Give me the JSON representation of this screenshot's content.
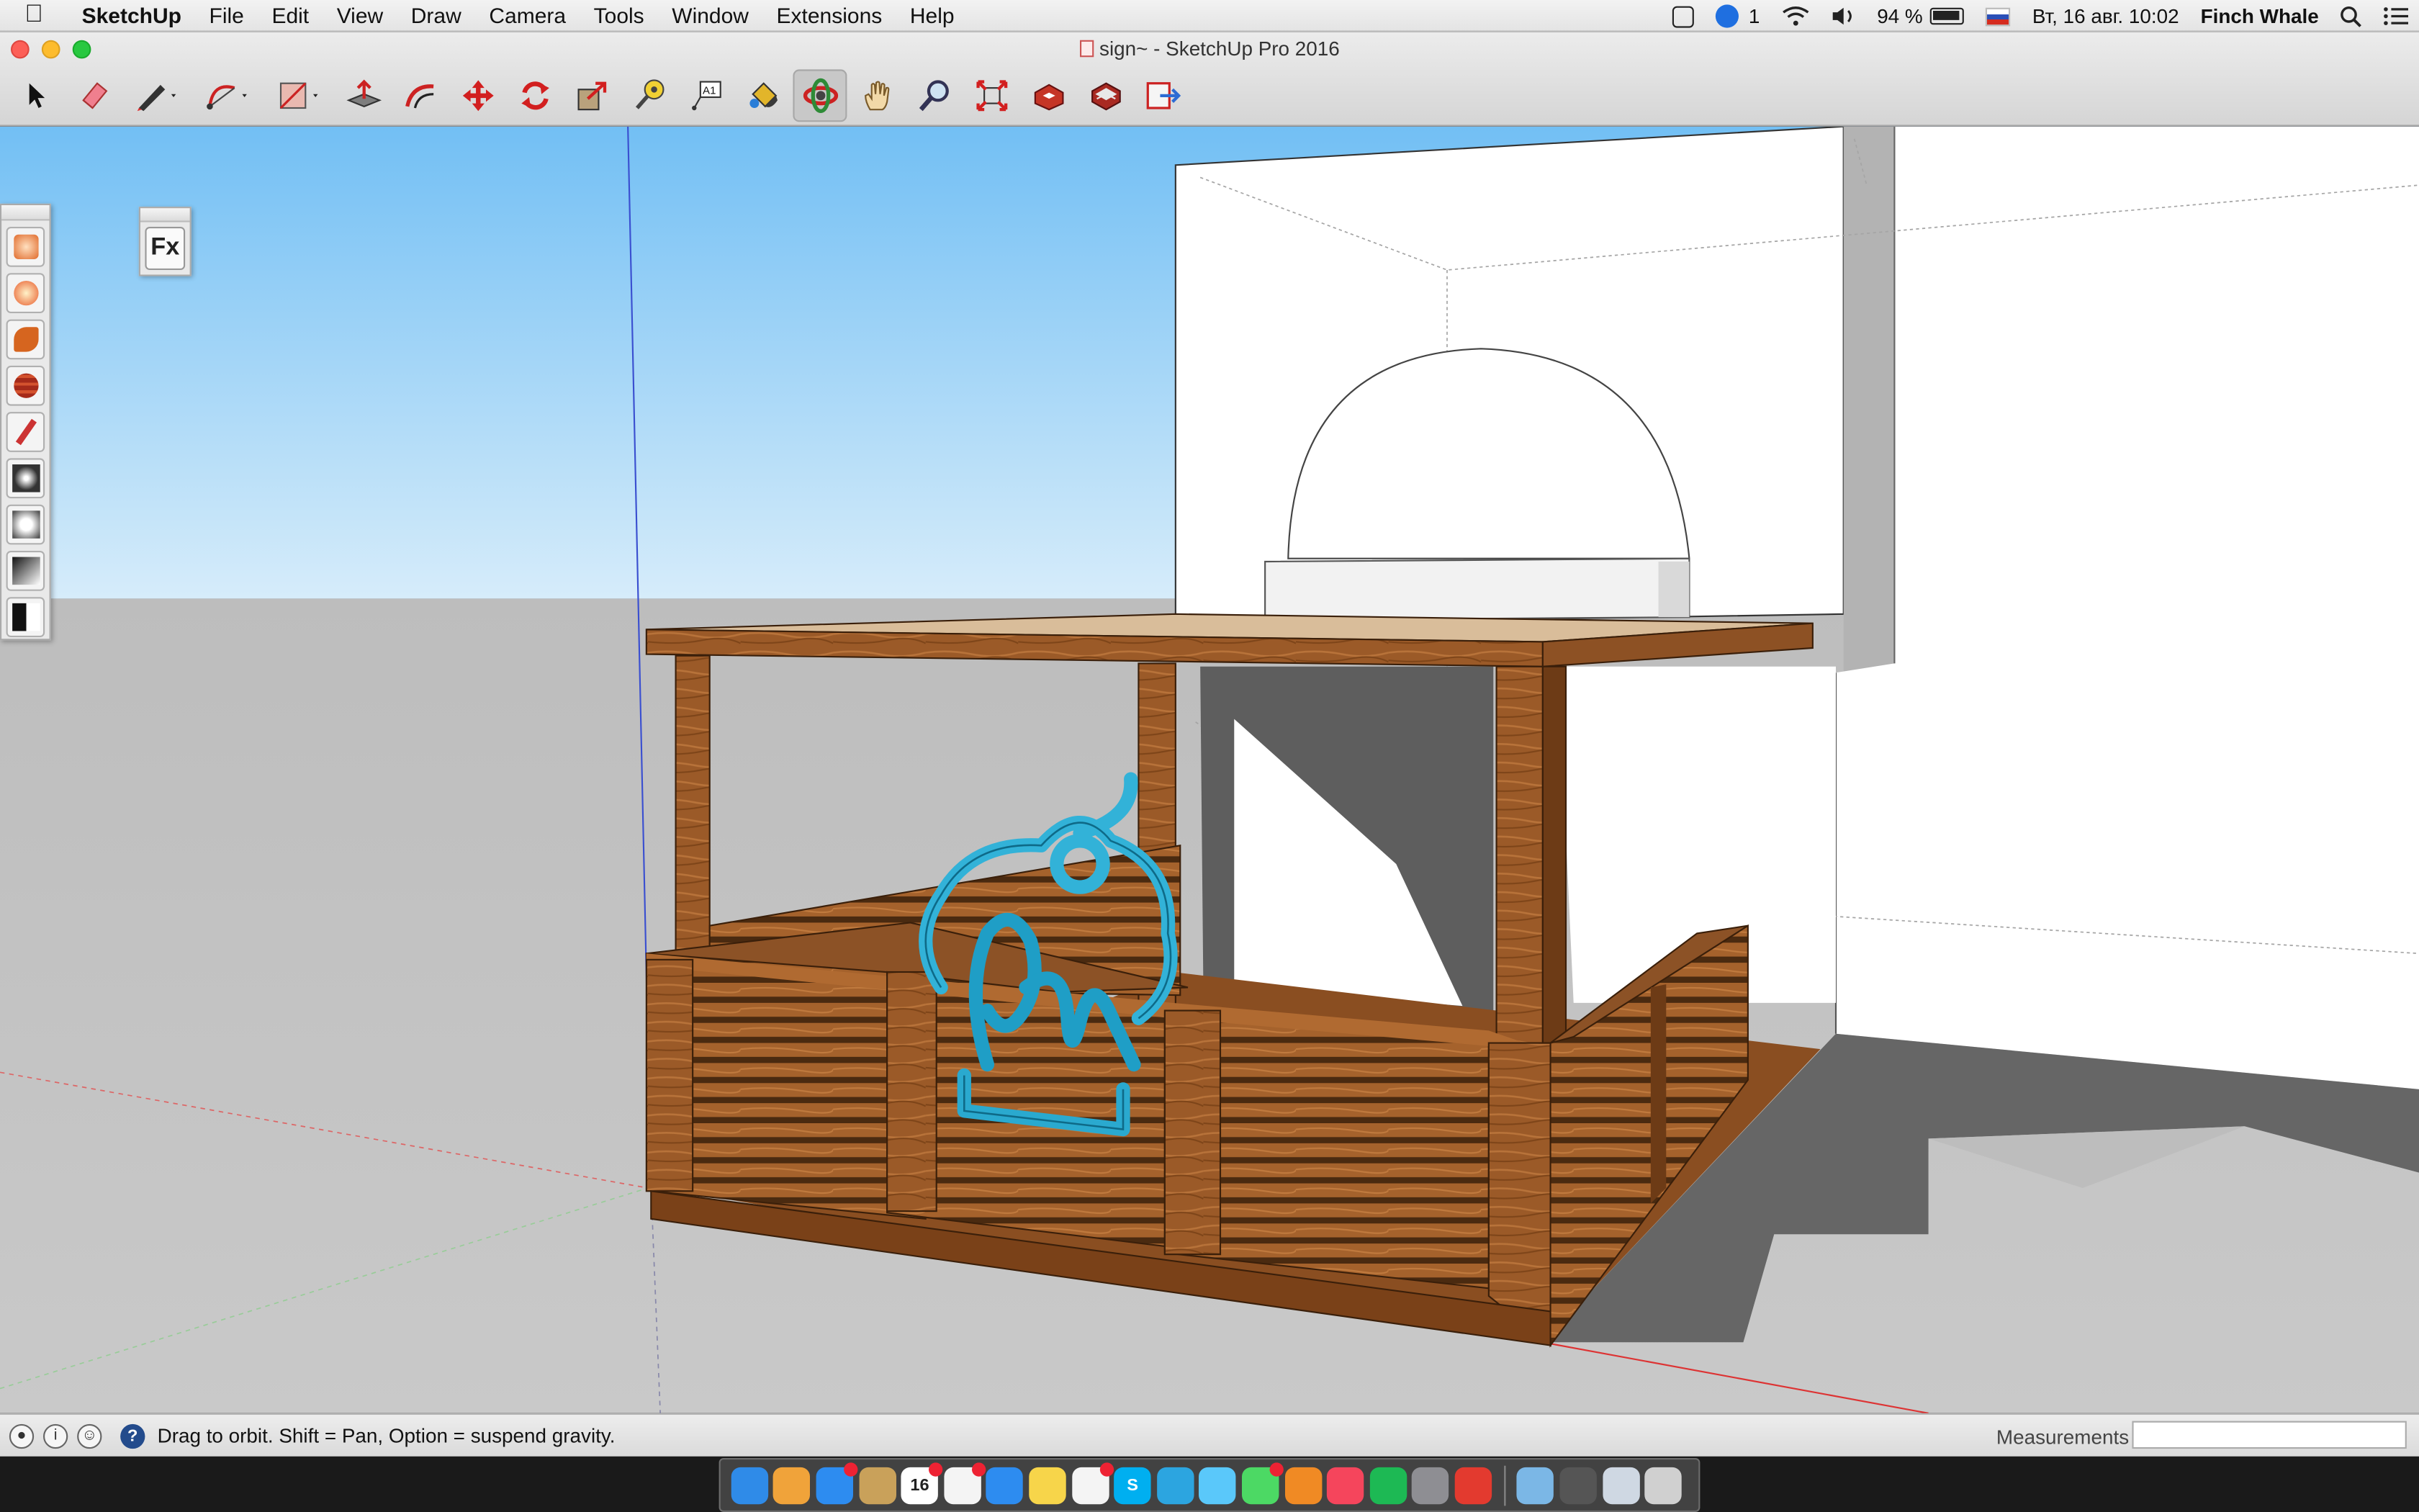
{
  "menubar": {
    "app_name": "SketchUp",
    "items": [
      "File",
      "Edit",
      "View",
      "Draw",
      "Camera",
      "Tools",
      "Window",
      "Extensions",
      "Help"
    ],
    "status": {
      "notification_count": "1",
      "battery_percent": "94 %",
      "datetime": "Вт, 16 авг.  10:02",
      "user": "Finch Whale"
    }
  },
  "window": {
    "title": "sign~ - SketchUp Pro 2016"
  },
  "toolbar": {
    "tools": [
      {
        "name": "select-tool",
        "icon": "arrow-cursor-icon"
      },
      {
        "name": "eraser-tool",
        "icon": "eraser-icon"
      },
      {
        "name": "line-tool",
        "icon": "pencil-icon",
        "dropdown": true
      },
      {
        "name": "arc-tool",
        "icon": "arc-icon",
        "dropdown": true
      },
      {
        "name": "shape-tool",
        "icon": "rectangle-icon",
        "dropdown": true
      },
      {
        "name": "push-pull-tool",
        "icon": "push-pull-icon"
      },
      {
        "name": "offset-tool",
        "icon": "offset-icon"
      },
      {
        "name": "move-tool",
        "icon": "move-icon"
      },
      {
        "name": "rotate-tool",
        "icon": "rotate-icon"
      },
      {
        "name": "scale-tool",
        "icon": "scale-icon"
      },
      {
        "name": "tape-measure-tool",
        "icon": "tape-measure-icon"
      },
      {
        "name": "text-tool",
        "icon": "text-icon"
      },
      {
        "name": "paint-bucket-tool",
        "icon": "paint-bucket-icon"
      },
      {
        "name": "orbit-tool",
        "icon": "orbit-icon",
        "active": true
      },
      {
        "name": "pan-tool",
        "icon": "hand-icon"
      },
      {
        "name": "zoom-tool",
        "icon": "magnifier-icon"
      },
      {
        "name": "zoom-extents-tool",
        "icon": "zoom-extents-icon"
      },
      {
        "name": "warehouse-tool",
        "icon": "warehouse-icon"
      },
      {
        "name": "extension-warehouse-tool",
        "icon": "extension-warehouse-icon"
      },
      {
        "name": "layout-send-tool",
        "icon": "layout-icon"
      }
    ]
  },
  "render_palette": {
    "buttons": [
      "render-icon",
      "light-bulb-icon",
      "material-editor-icon",
      "texture-icon",
      "paint-icon",
      "light-icon",
      "sphere-icon",
      "gradient-icon",
      "section-icon"
    ]
  },
  "fx_palette": {
    "label": "Fx"
  },
  "statusbar": {
    "hint": "Drag to orbit. Shift = Pan, Option = suspend gravity.",
    "measurements_label": "Measurements",
    "measurements_value": ""
  },
  "dock": {
    "apps": [
      {
        "name": "finder",
        "color": "#2f8be8"
      },
      {
        "name": "photos",
        "color": "#f0a33a"
      },
      {
        "name": "app-store",
        "color": "#2d8cf0",
        "badge": true
      },
      {
        "name": "notes-book",
        "color": "#c9a15a"
      },
      {
        "name": "calendar",
        "color": "#ffffff",
        "label": "16",
        "badge": true
      },
      {
        "name": "reminders",
        "color": "#f4f4f4",
        "badge": true
      },
      {
        "name": "safari",
        "color": "#2d8cf0"
      },
      {
        "name": "notes",
        "color": "#f7d54a"
      },
      {
        "name": "lists",
        "color": "#f4f4f4",
        "badge": true
      },
      {
        "name": "skype",
        "color": "#00aff0",
        "label": "S"
      },
      {
        "name": "telegram",
        "color": "#2ca5e0"
      },
      {
        "name": "messages",
        "color": "#5ac8fa"
      },
      {
        "name": "facetime",
        "color": "#4cd964",
        "badge": true
      },
      {
        "name": "ibooks",
        "color": "#f08a24"
      },
      {
        "name": "itunes",
        "color": "#f5455c"
      },
      {
        "name": "spotify",
        "color": "#1db954"
      },
      {
        "name": "system-preferences",
        "color": "#8e8e93"
      },
      {
        "name": "sketchup",
        "color": "#e33a2f"
      }
    ],
    "right_items": [
      {
        "name": "applications-folder",
        "color": "#7bb7e6"
      },
      {
        "name": "document-stack",
        "color": "#555555"
      },
      {
        "name": "downloads-folder",
        "color": "#cfd8e3"
      },
      {
        "name": "trash",
        "color": "#d0d0d0"
      }
    ]
  }
}
